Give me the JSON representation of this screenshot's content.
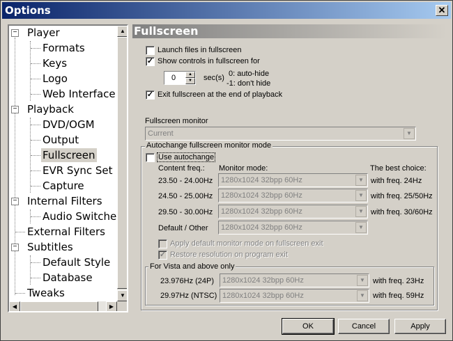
{
  "window": {
    "title": "Options",
    "close_glyph": "✕"
  },
  "tree": {
    "items": [
      {
        "label": "Player"
      },
      {
        "label": "Formats"
      },
      {
        "label": "Keys"
      },
      {
        "label": "Logo"
      },
      {
        "label": "Web Interface"
      },
      {
        "label": "Playback"
      },
      {
        "label": "DVD/OGM"
      },
      {
        "label": "Output"
      },
      {
        "label": "Fullscreen"
      },
      {
        "label": "EVR Sync Set"
      },
      {
        "label": "Capture"
      },
      {
        "label": "Internal Filters"
      },
      {
        "label": "Audio Switche"
      },
      {
        "label": "External Filters"
      },
      {
        "label": "Subtitles"
      },
      {
        "label": "Default Style"
      },
      {
        "label": "Database"
      },
      {
        "label": "Tweaks"
      }
    ],
    "selected": "Fullscreen"
  },
  "page": {
    "header": "Fullscreen",
    "launch_fullscreen": {
      "label": "Launch files in fullscreen",
      "checked": false
    },
    "show_controls": {
      "label": "Show controls in fullscreen for",
      "checked": true
    },
    "seconds": {
      "value": "0",
      "unit": "sec(s)",
      "hint1": "0: auto-hide",
      "hint2": "-1: don't hide"
    },
    "exit_fullscreen": {
      "label": "Exit fullscreen at the end of playback",
      "checked": true
    },
    "monitor_label": "Fullscreen monitor",
    "monitor_value": "Current",
    "autochange_group": "Autochange fullscreen monitor mode",
    "use_autochange": {
      "label": "Use autochange",
      "checked": false
    },
    "col_content": "Content freq.:",
    "col_monitor": "Monitor mode:",
    "col_best": "The best choice:",
    "rows": [
      {
        "freq": "23.50 - 24.00Hz",
        "mode": "1280x1024 32bpp 60Hz",
        "best": "with freq. 24Hz"
      },
      {
        "freq": "24.50 - 25.00Hz",
        "mode": "1280x1024 32bpp 60Hz",
        "best": "with freq. 25/50Hz"
      },
      {
        "freq": "29.50 - 30.00Hz",
        "mode": "1280x1024 32bpp 60Hz",
        "best": "with freq. 30/60Hz"
      },
      {
        "freq": "Default / Other",
        "mode": "1280x1024 32bpp 60Hz",
        "best": ""
      }
    ],
    "apply_default": {
      "label": "Apply default monitor mode on fullscreen exit",
      "checked": false
    },
    "restore_res": {
      "label": "Restore resolution on program exit",
      "checked": true
    },
    "vista_group": "For Vista and above only",
    "vista_rows": [
      {
        "freq": "23.976Hz (24P)",
        "mode": "1280x1024 32bpp 60Hz",
        "best": "with freq. 23Hz"
      },
      {
        "freq": "29.97Hz (NTSC)",
        "mode": "1280x1024 32bpp 60Hz",
        "best": "with freq. 59Hz"
      }
    ]
  },
  "buttons": {
    "ok": "OK",
    "cancel": "Cancel",
    "apply": "Apply"
  }
}
